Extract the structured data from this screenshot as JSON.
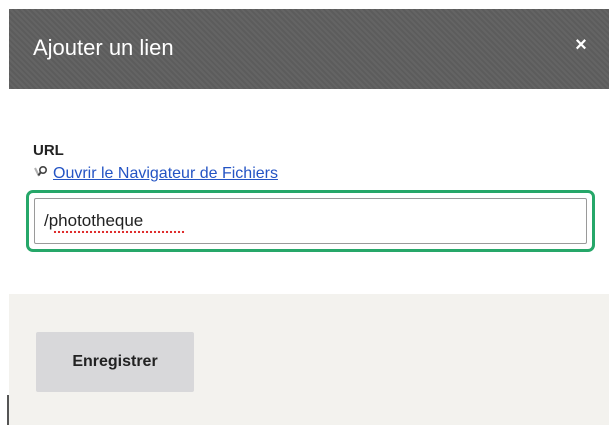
{
  "dialog": {
    "title": "Ajouter un lien",
    "close_label": "×"
  },
  "form": {
    "url_label": "URL",
    "file_browser_link": "Ouvrir le Navigateur de Fichiers",
    "url_value": "/phototheque"
  },
  "footer": {
    "save_label": "Enregistrer"
  },
  "icons": {
    "close": "close-icon",
    "file_browser": "magnifier-icon"
  },
  "colors": {
    "titlebar": "#5f5f5f",
    "focus_ring": "#26a769",
    "link": "#2454c4",
    "footer_bg": "#f3f2ee",
    "button_bg": "#d8d8da"
  }
}
